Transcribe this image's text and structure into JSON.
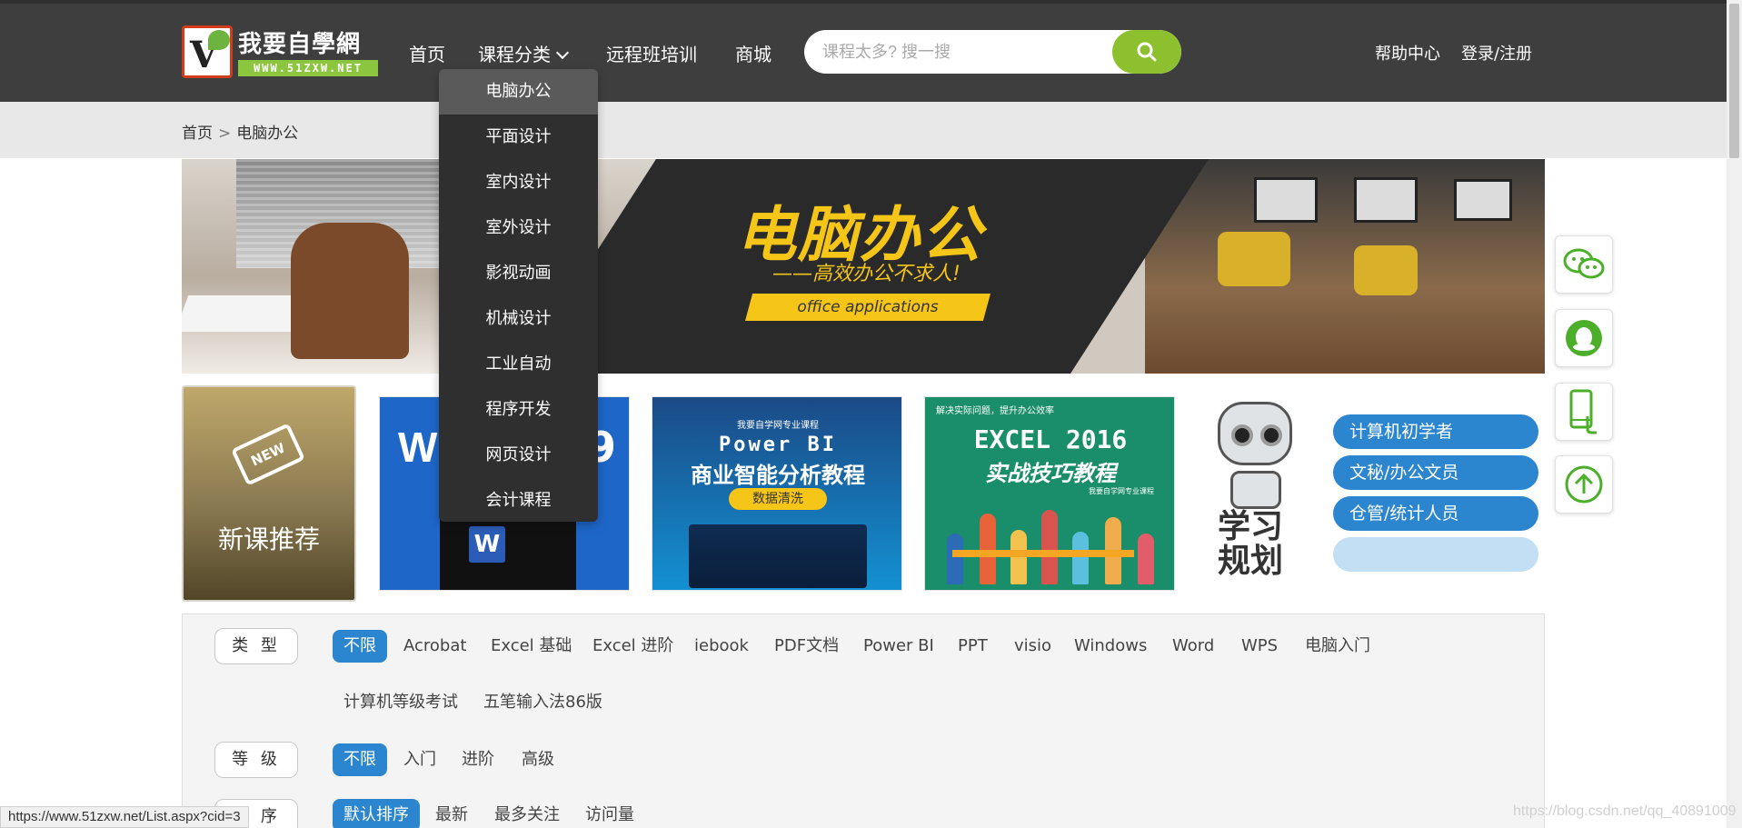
{
  "header": {
    "logo_title": "我要自學網",
    "logo_url": "WWW.51ZXW.NET",
    "nav": {
      "home": "首页",
      "course_category": "课程分类",
      "remote_training": "远程班培训",
      "mall": "商城"
    },
    "search": {
      "placeholder": "课程太多? 搜一搜"
    },
    "help": "帮助中心",
    "login": "登录/注册"
  },
  "dropdown": {
    "items": [
      "电脑办公",
      "平面设计",
      "室内设计",
      "室外设计",
      "影视动画",
      "机械设计",
      "工业自动",
      "程序开发",
      "网页设计",
      "会计课程"
    ],
    "highlighted": "电脑办公"
  },
  "breadcrumb": {
    "home": "首页",
    "separator": ">",
    "current": "电脑办公"
  },
  "banner": {
    "title": "电脑办公",
    "subtitle": "——高效办公不求人!",
    "tag": "office applications"
  },
  "new_course": {
    "tag": "NEW",
    "label": "新课推荐"
  },
  "cards": [
    {
      "big_left": "W",
      "big_right": "9",
      "icon": "W"
    },
    {
      "small": "我要自学网专业课程",
      "title": "Power BI",
      "subtitle": "商业智能分析教程",
      "pill": "数据清洗"
    },
    {
      "head": "解决实际问题，提升办公效率",
      "title": "EXCEL 2016",
      "subtitle": "实战技巧教程",
      "small": "我要自学网专业课程"
    }
  ],
  "study_plan": {
    "title_line1": "学习",
    "title_line2": "规划",
    "buttons": [
      "计算机初学者",
      "文秘/办公文员",
      "仓管/统计人员",
      ""
    ]
  },
  "filter": {
    "type": {
      "label": "类 型",
      "items": [
        "不限",
        "Acrobat",
        "Excel 基础",
        "Excel 进阶",
        "iebook",
        "PDF文档",
        "Power BI",
        "PPT",
        "visio",
        "Windows",
        "Word",
        "WPS",
        "电脑入门",
        "计算机等级考试",
        "五笔输入法86版"
      ],
      "active": "不限"
    },
    "level": {
      "label": "等 级",
      "items": [
        "不限",
        "入门",
        "进阶",
        "高级"
      ],
      "active": "不限"
    },
    "sort": {
      "label": "排 序",
      "items": [
        "默认排序",
        "最新",
        "最多关注",
        "访问量"
      ],
      "active": "默认排序"
    }
  },
  "side_buttons": [
    "wechat-icon",
    "qq-icon",
    "mobile-icon",
    "back-to-top-icon"
  ],
  "status_url": "https://www.51zxw.net/List.aspx?cid=3",
  "watermark": "https://blog.csdn.net/qq_40891009",
  "colors": {
    "header_bg": "#3e3e3e",
    "accent_green": "#8cc02f",
    "accent_blue": "#2b85cf",
    "banner_yellow": "#f5c518",
    "dropdown_bg": "#2f2f2f"
  }
}
